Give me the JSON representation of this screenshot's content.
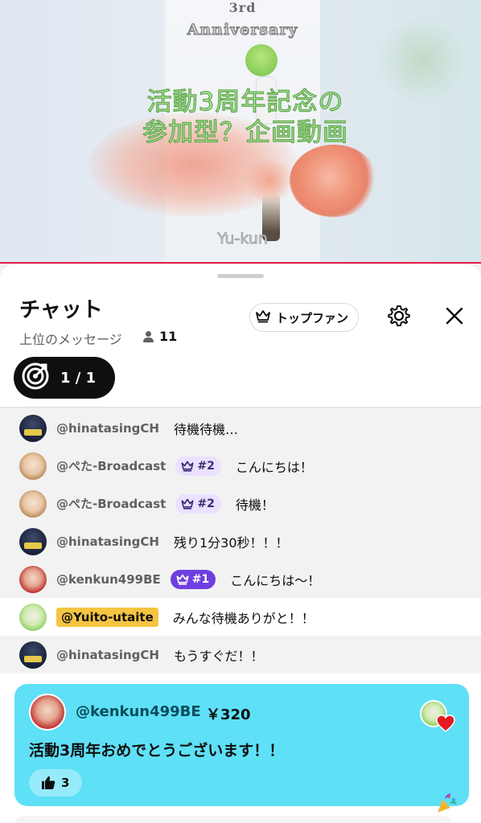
{
  "video": {
    "title_top": "3rd",
    "anniversary": "Anniversary",
    "main_line1": "活動3周年記念の",
    "main_line2": "参加型？企画動画",
    "channel_name": "Yu-kun"
  },
  "chat": {
    "title": "チャット",
    "subtitle": "上位のメッセージ",
    "viewer_count": "11",
    "top_fan_label": "トップファン",
    "goal_progress": "1 / 1"
  },
  "messages": [
    {
      "author": "@hinatasingCH",
      "text": "待機待機…",
      "badge": ""
    },
    {
      "author": "@ぺた-Broadcast",
      "text": "こんにちは！",
      "badge": "#2"
    },
    {
      "author": "@ぺた-Broadcast",
      "text": "待機！",
      "badge": "#2"
    },
    {
      "author": "@hinatasingCH",
      "text": "残り1分30秒！！！",
      "badge": ""
    },
    {
      "author": "@kenkun499BE",
      "text": "こんにちは〜！",
      "badge": "#1"
    },
    {
      "author": "@Yuito-utaite",
      "text": "みんな待機ありがと！！",
      "badge": ""
    },
    {
      "author": "@hinatasingCH",
      "text": "もうすぐだ！！",
      "badge": ""
    }
  ],
  "superchat": {
    "author": "@kenkun499BE",
    "amount": "￥320",
    "text": "活動3周年おめでとうございます！！",
    "likes": "3"
  },
  "colors": {
    "superchat_bg": "#5ee0f7",
    "owner_badge": "#f5c542",
    "top_badge": "#6e3fe0",
    "rank_badge": "#ebe0ff",
    "progress_bar": "#e11d48"
  },
  "icons": [
    "crown-icon",
    "gear-icon",
    "close-icon",
    "goal-target-icon",
    "person-icon",
    "thumbs-up-icon",
    "heart-icon",
    "party-popper-icon"
  ]
}
